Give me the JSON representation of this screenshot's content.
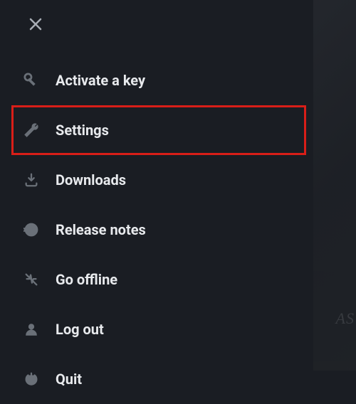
{
  "menu": {
    "items": [
      {
        "label": "Activate a key"
      },
      {
        "label": "Settings"
      },
      {
        "label": "Downloads"
      },
      {
        "label": "Release notes"
      },
      {
        "label": "Go offline"
      },
      {
        "label": "Log out"
      },
      {
        "label": "Quit"
      }
    ]
  },
  "highlight_index": 1,
  "bg_text": "AS"
}
